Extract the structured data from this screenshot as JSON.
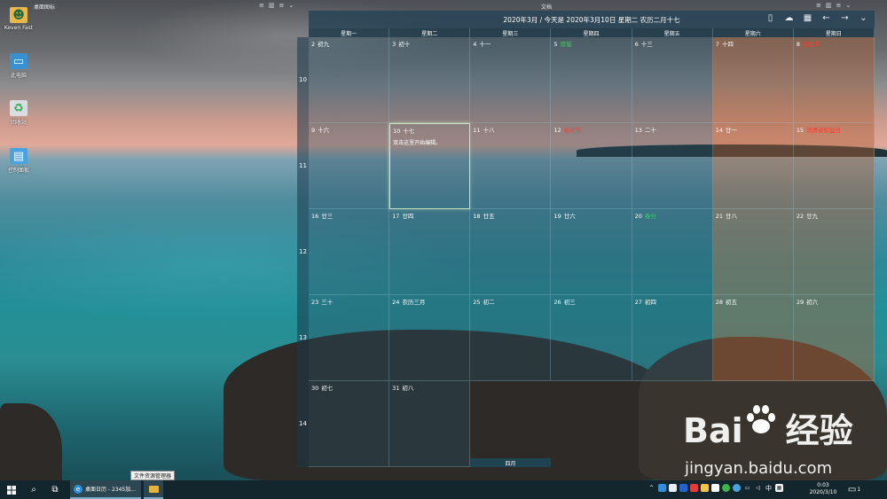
{
  "desktop": {
    "icons": [
      {
        "label": "Keven Fast",
        "icon": "user-folder-icon"
      },
      {
        "label": "此电脑",
        "icon": "computer-icon"
      },
      {
        "label": "回收站",
        "icon": "recycle-bin-icon"
      },
      {
        "label": "控制面板",
        "icon": "control-panel-icon"
      }
    ]
  },
  "top_strip": {
    "left_title": "桌面图标",
    "right_title": "文档",
    "controls": [
      "≡",
      "▥",
      "≡",
      "⌄"
    ]
  },
  "calendar": {
    "title": "2020年3月 / 今天是 2020年3月10日 星期二 农历二月十七",
    "toolbar": [
      {
        "name": "phone-icon",
        "glyph": "▯"
      },
      {
        "name": "cloud-icon",
        "glyph": "☁"
      },
      {
        "name": "calendar-icon",
        "glyph": "▦"
      },
      {
        "name": "arrow-left-icon",
        "glyph": "←"
      },
      {
        "name": "arrow-right-icon",
        "glyph": "→"
      },
      {
        "name": "chevron-down-icon",
        "glyph": "⌄"
      }
    ],
    "weekdays": [
      "星期一",
      "星期二",
      "星期三",
      "星期四",
      "星期五",
      "星期六",
      "星期日"
    ],
    "week_numbers": [
      "10",
      "11",
      "12",
      "13",
      "14"
    ],
    "weeks": [
      [
        {
          "day": "2",
          "lunar": "初九"
        },
        {
          "day": "3",
          "lunar": "初十"
        },
        {
          "day": "4",
          "lunar": "十一"
        },
        {
          "day": "5",
          "lunar": "惊蛰",
          "style": "green"
        },
        {
          "day": "6",
          "lunar": "十三"
        },
        {
          "day": "7",
          "lunar": "十四"
        },
        {
          "day": "8",
          "lunar": "妇女节",
          "style": "red"
        }
      ],
      [
        {
          "day": "9",
          "lunar": "十六"
        },
        {
          "day": "10",
          "lunar": "十七",
          "note": "双击这里开始编辑。",
          "today": true
        },
        {
          "day": "11",
          "lunar": "十八"
        },
        {
          "day": "12",
          "lunar": "植树节",
          "style": "red"
        },
        {
          "day": "13",
          "lunar": "二十"
        },
        {
          "day": "14",
          "lunar": "廿一"
        },
        {
          "day": "15",
          "lunar": "消费者权益日",
          "style": "red"
        }
      ],
      [
        {
          "day": "16",
          "lunar": "廿三"
        },
        {
          "day": "17",
          "lunar": "廿四"
        },
        {
          "day": "18",
          "lunar": "廿五"
        },
        {
          "day": "19",
          "lunar": "廿六"
        },
        {
          "day": "20",
          "lunar": "春分",
          "style": "green"
        },
        {
          "day": "21",
          "lunar": "廿八"
        },
        {
          "day": "22",
          "lunar": "廿九"
        }
      ],
      [
        {
          "day": "23",
          "lunar": "三十"
        },
        {
          "day": "24",
          "lunar": "农历三月"
        },
        {
          "day": "25",
          "lunar": "初二"
        },
        {
          "day": "26",
          "lunar": "初三"
        },
        {
          "day": "27",
          "lunar": "初四"
        },
        {
          "day": "28",
          "lunar": "初五"
        },
        {
          "day": "29",
          "lunar": "初六"
        }
      ],
      [
        {
          "day": "30",
          "lunar": "初七"
        },
        {
          "day": "31",
          "lunar": "初八"
        }
      ]
    ],
    "next_month_label": "四月"
  },
  "watermark": {
    "logo_left": "Bai",
    "logo_right": "经验",
    "url": "jingyan.baidu.com"
  },
  "tooltip": "文件资源管理器",
  "taskbar": {
    "app_label": "桌面日历 - 2345加...",
    "tray_chevron": "^",
    "ime_label": "中",
    "time": "0:03",
    "date": "2020/3/10",
    "notification_count": "1"
  },
  "colors": {
    "lunar_green": "#39d25a",
    "lunar_red": "#ff3b30",
    "weekend_tint": "#aa5f37",
    "taskbar": "#13262e"
  }
}
